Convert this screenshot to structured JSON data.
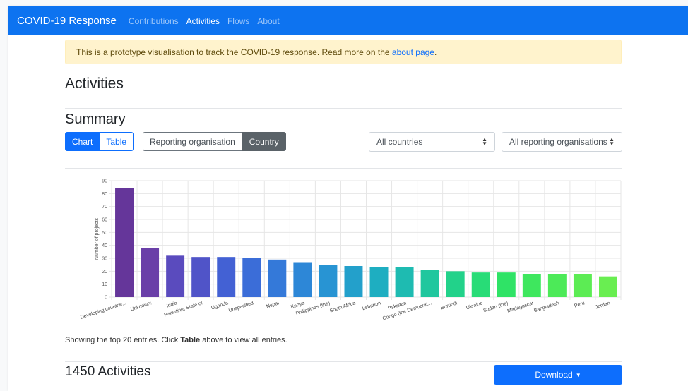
{
  "navbar": {
    "brand": "COVID-19 Response",
    "links": [
      "Contributions",
      "Activities",
      "Flows",
      "About"
    ],
    "active": "Activities"
  },
  "alert": {
    "text": "This is a prototype visualisation to track the COVID-19 response. Read more on the ",
    "link": "about page",
    "end": "."
  },
  "page_title": "Activities",
  "summary": {
    "title": "Summary",
    "view_buttons": {
      "chart": "Chart",
      "table": "Table",
      "selected": "Chart"
    },
    "group_buttons": {
      "org": "Reporting organisation",
      "country": "Country",
      "selected": "Country"
    },
    "country_select": "All countries",
    "org_select": "All reporting organisations"
  },
  "chart_data": {
    "type": "bar",
    "ylabel": "Number of projects",
    "ylim": [
      0,
      90
    ],
    "yticks": [
      0,
      10,
      20,
      30,
      40,
      50,
      60,
      70,
      80,
      90
    ],
    "grid": true,
    "categories": [
      "Developing countrie...",
      "Unknown:",
      "India",
      "Palestine, State of",
      "Uganda",
      "Unspecified",
      "Nepal",
      "Kenya",
      "Philippines (the)",
      "South Africa",
      "Lebanon",
      "Pakistan",
      "Congo (the Democrat...",
      "Burundi",
      "Ukraine",
      "Sudan (the)",
      "Madagascar",
      "Bangladesh",
      "Peru",
      "Jordan"
    ],
    "values": [
      84,
      38,
      32,
      31,
      31,
      30,
      29,
      27,
      25,
      24,
      23,
      23,
      21,
      20,
      19,
      19,
      18,
      18,
      18,
      16
    ],
    "colors": [
      "#65369a",
      "#6a3fa8",
      "#5a4bbe",
      "#5054c8",
      "#4361d4",
      "#3b6dd8",
      "#3479d9",
      "#2d87d7",
      "#2894d3",
      "#23a0cb",
      "#1eaec1",
      "#1ebbb1",
      "#20c79e",
      "#22d28a",
      "#28dc77",
      "#2fe366",
      "#3ee75e",
      "#4cea58",
      "#5cec54",
      "#69ee51"
    ]
  },
  "showing": {
    "pre": "Showing the top 20 entries. Click ",
    "bold": "Table",
    "post": " above to view all entries."
  },
  "activities_count": "1450 Activities",
  "download_label": "Download"
}
